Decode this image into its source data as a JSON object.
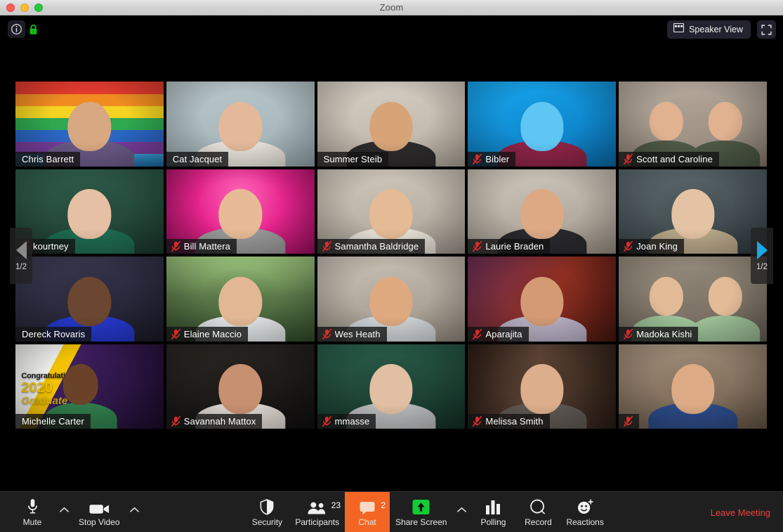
{
  "window": {
    "title": "Zoom",
    "traffic_lights": [
      "close",
      "minimize",
      "maximize"
    ]
  },
  "topbar": {
    "info_icon": "info-icon",
    "lock_icon": "lock-icon",
    "view_label": "Speaker View",
    "view_icon": "grid-view-icon",
    "fullscreen_icon": "fullscreen-icon"
  },
  "pagination": {
    "prev_label": "1/2",
    "next_label": "1/2",
    "prev_icon": "chevron-left-icon",
    "next_icon": "chevron-right-icon",
    "prev_active": false,
    "next_active": true
  },
  "gallery": {
    "columns": 5,
    "rows": 4,
    "participants": [
      {
        "name": "Chris Barrett",
        "muted": false,
        "speaking": false,
        "bg": "#3ba3dd",
        "bg2": "#1d6fa8",
        "skin": "#d8a882",
        "shirt": "#6a5a86",
        "theme": "pride"
      },
      {
        "name": "Cat Jacquet",
        "muted": false,
        "speaking": true,
        "bg": "#b9c6c9",
        "bg2": "#9fb2b8",
        "skin": "#e3b999",
        "shirt": "#e8e4dc",
        "theme": "room"
      },
      {
        "name": "Summer Steib",
        "muted": false,
        "speaking": false,
        "bg": "#d6cfc4",
        "bg2": "#b9b0a2",
        "skin": "#d7a377",
        "shirt": "#2e2b2c",
        "theme": "room"
      },
      {
        "name": "Bibler",
        "muted": true,
        "speaking": false,
        "bg": "#18a8f0",
        "bg2": "#0a73b8",
        "skin": "#5fc6f4",
        "shirt": "#8e2447",
        "theme": "blue"
      },
      {
        "name": "Scott and Caroline",
        "muted": true,
        "speaking": false,
        "bg": "#b9ada0",
        "bg2": "#8e8276",
        "skin": "#e0b28f",
        "shirt": "#4e5a46",
        "theme": "duo"
      },
      {
        "name": "kourtney",
        "muted": true,
        "speaking": false,
        "bg": "#2f5e4b",
        "bg2": "#1d3b30",
        "skin": "#e6c0a5",
        "shirt": "#1f6b52",
        "theme": "room"
      },
      {
        "name": "Bill Mattera",
        "muted": true,
        "speaking": false,
        "bg": "#e8258e",
        "bg2": "#a61065",
        "skin": "#e8bb96",
        "shirt": "#9a9a9a",
        "theme": "pink"
      },
      {
        "name": "Samantha Baldridge",
        "muted": true,
        "speaking": false,
        "bg": "#d2cabd",
        "bg2": "#a9a095",
        "skin": "#e5bb96",
        "shirt": "#e6e2d8",
        "theme": "room"
      },
      {
        "name": "Laurie Braden",
        "muted": true,
        "speaking": false,
        "bg": "#cfc8bc",
        "bg2": "#a49a8e",
        "skin": "#dda985",
        "shirt": "#2a2a2e",
        "theme": "room"
      },
      {
        "name": "Joan King",
        "muted": true,
        "speaking": false,
        "bg": "#5e6b6f",
        "bg2": "#333c41",
        "skin": "#e4c3a5",
        "shirt": "#b9a88a",
        "theme": "dark"
      },
      {
        "name": "Dereck Rovaris",
        "muted": false,
        "speaking": false,
        "bg": "#3b3a52",
        "bg2": "#1c1b2a",
        "skin": "#6b4630",
        "shirt": "#2437c8",
        "theme": "dark"
      },
      {
        "name": "Elaine Maccio",
        "muted": true,
        "speaking": false,
        "bg": "#5c7a4a",
        "bg2": "#35502d",
        "skin": "#e2b894",
        "shirt": "#dfe2e4",
        "theme": "garden"
      },
      {
        "name": "Wes Heath",
        "muted": true,
        "speaking": false,
        "bg": "#c9c2b6",
        "bg2": "#9b9286",
        "skin": "#dfa980",
        "shirt": "#cfd3d6",
        "theme": "room"
      },
      {
        "name": "Aparajita",
        "muted": true,
        "speaking": false,
        "bg": "#8e2e20",
        "bg2": "#4b1710",
        "skin": "#d39a74",
        "shirt": "#b6afc2",
        "theme": "warm"
      },
      {
        "name": "Madoka Kishi",
        "muted": true,
        "speaking": false,
        "bg": "#9a8f80",
        "bg2": "#6b6357",
        "skin": "#e3bb97",
        "shirt": "#9fc39a",
        "theme": "duo"
      },
      {
        "name": "Michelle Carter",
        "muted": false,
        "speaking": false,
        "bg": "#3d1e5e",
        "bg2": "#1c0c2c",
        "skin": "#6a4228",
        "shirt": "#2f7a4a",
        "theme": "grad"
      },
      {
        "name": "Savannah Mattox",
        "muted": true,
        "speaking": false,
        "bg": "#2a2622",
        "bg2": "#121010",
        "skin": "#c79070",
        "shirt": "#dcd6cf",
        "theme": "dark"
      },
      {
        "name": "mmasse",
        "muted": true,
        "speaking": false,
        "bg": "#2a5f4c",
        "bg2": "#153227",
        "skin": "#e0bfa2",
        "shirt": "#b7b9ba",
        "theme": "green"
      },
      {
        "name": "Melissa Smith",
        "muted": true,
        "speaking": false,
        "bg": "#5a4234",
        "bg2": "#2b1d15",
        "skin": "#dcae8b",
        "shirt": "#5d5752",
        "theme": "books"
      },
      {
        "name": "",
        "muted": true,
        "speaking": false,
        "bg": "#a3907c",
        "bg2": "#6b5a48",
        "skin": "#dcaa84",
        "shirt": "#2b4a86",
        "theme": "room"
      }
    ],
    "graduation_overlay": {
      "line1": "Congratulations",
      "line2": "2020",
      "line3": "Graduate"
    }
  },
  "toolbar": {
    "mute": {
      "label": "Mute",
      "icon": "microphone-icon"
    },
    "mute_chevron": "chevron-up-icon",
    "video": {
      "label": "Stop Video",
      "icon": "video-camera-icon"
    },
    "video_chevron": "chevron-up-icon",
    "security": {
      "label": "Security",
      "icon": "shield-icon"
    },
    "participants": {
      "label": "Participants",
      "icon": "people-icon",
      "count": "23"
    },
    "chat": {
      "label": "Chat",
      "icon": "chat-bubble-icon",
      "count": "2",
      "active": true,
      "accent": "#f26522"
    },
    "share": {
      "label": "Share Screen",
      "icon": "share-screen-icon",
      "accent": "#12cc34"
    },
    "share_chevron": "chevron-up-icon",
    "polling": {
      "label": "Polling",
      "icon": "bar-chart-icon"
    },
    "record": {
      "label": "Record",
      "icon": "record-circle-icon"
    },
    "reactions": {
      "label": "Reactions",
      "icon": "smiley-plus-icon"
    },
    "leave": {
      "label": "Leave Meeting",
      "color": "#e8453c"
    }
  }
}
